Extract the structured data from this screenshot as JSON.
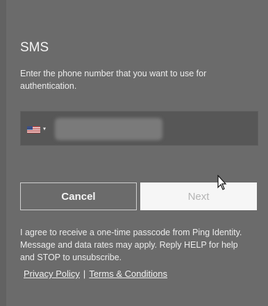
{
  "title": "SMS",
  "description": "Enter the phone number that you want to use for authentication.",
  "phone": {
    "country_icon": "us-flag-icon",
    "caret": "▾",
    "value": ""
  },
  "buttons": {
    "cancel_label": "Cancel",
    "next_label": "Next"
  },
  "consent": "I agree to receive a one-time passcode from Ping Identity. Message and data rates may apply. Reply HELP for help and STOP to unsubscribe.",
  "links": {
    "privacy": "Privacy Policy",
    "separator": "|",
    "terms": "Terms & Conditions"
  },
  "colors": {
    "background": "#6b6b6b",
    "next_button_bg": "#f6f6f6",
    "next_button_text": "#b4b4b4"
  }
}
